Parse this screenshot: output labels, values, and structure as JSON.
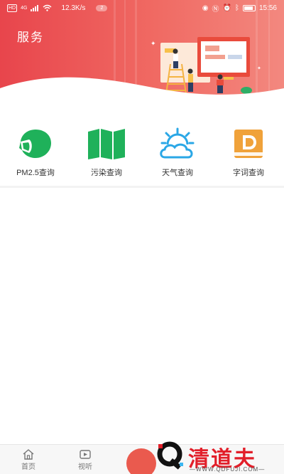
{
  "status_bar": {
    "hd_label": "HD",
    "network": "4G",
    "speed": "12.3K/s",
    "notification_count": "2",
    "time": "15:56"
  },
  "header": {
    "title": "服务"
  },
  "services": [
    {
      "label": "PM2.5查询",
      "icon": "mask-icon",
      "color": "#1fb15a"
    },
    {
      "label": "污染查询",
      "icon": "map-icon",
      "color": "#1fb15a"
    },
    {
      "label": "天气查询",
      "icon": "weather-icon",
      "color": "#2aa7e6"
    },
    {
      "label": "字词查询",
      "icon": "dictionary-icon",
      "color": "#f0a23a"
    }
  ],
  "bottom_nav": {
    "home_label": "首页",
    "media_label": "视听"
  },
  "watermark": {
    "brand": "清道夫",
    "url": "—WWW.QDFUJI.COM—"
  },
  "colors": {
    "header_start": "#e8454c",
    "header_end": "#f3887f",
    "green": "#1fb15a",
    "blue": "#2aa7e6",
    "orange": "#f0a23a"
  }
}
